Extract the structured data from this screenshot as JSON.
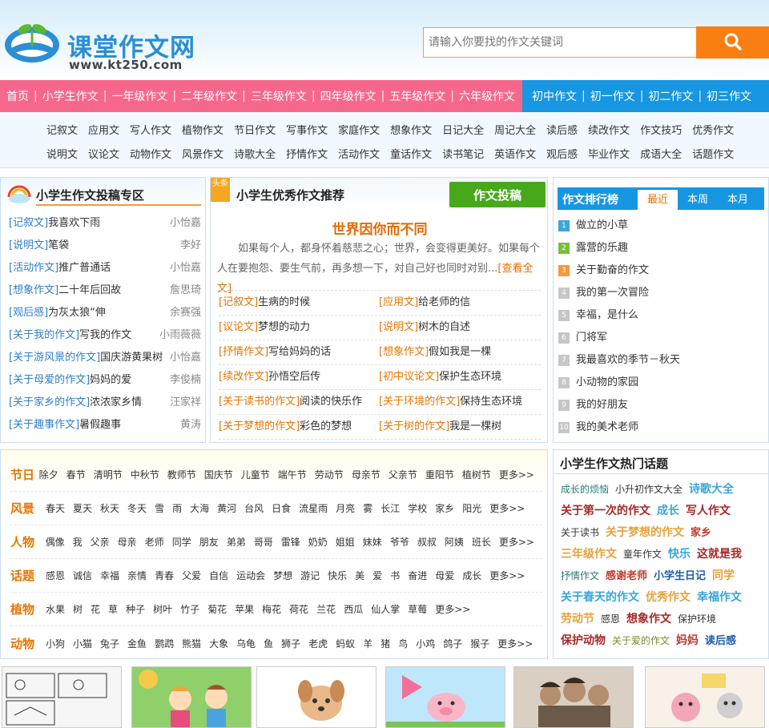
{
  "header": {
    "site_name": "课堂作文网",
    "site_url": "www.kt250.com",
    "search_placeholder": "请输入你要找的作文关键词",
    "search_icon": "search-icon"
  },
  "nav": {
    "main_items": [
      "首页",
      "小学生作文",
      "一年级作文",
      "二年级作文",
      "三年级作文",
      "四年级作文",
      "五年级作文",
      "六年级作文"
    ],
    "junior_items": [
      "初中作文",
      "初一作文",
      "初二作文",
      "初三作文"
    ],
    "primary_color": "#f7678c",
    "secondary_color": "#1796e2"
  },
  "subnav": {
    "row1": [
      "记叙文",
      "应用文",
      "写人作文",
      "植物作文",
      "节日作文",
      "写事作文",
      "家庭作文",
      "想象作文",
      "日记大全",
      "周记大全",
      "读后感",
      "续改作文",
      "作文技巧",
      "优秀作文"
    ],
    "row2": [
      "说明文",
      "议论文",
      "动物作文",
      "风景作文",
      "诗歌大全",
      "抒情作文",
      "活动作文",
      "童话作文",
      "读书笔记",
      "英语作文",
      "观后感",
      "毕业作文",
      "成语大全",
      "话题作文"
    ]
  },
  "submission": {
    "title": "小学生作文投稿专区",
    "items": [
      {
        "category": "[记叙文]",
        "title": "我喜欢下雨",
        "author": "小怡嘉"
      },
      {
        "category": "[说明文]",
        "title": "笔袋",
        "author": "李好"
      },
      {
        "category": "[活动作文]",
        "title": "推广普通话",
        "author": "小怡嘉"
      },
      {
        "category": "[想象作文]",
        "title": "二十年后回故",
        "author": "詹思琦"
      },
      {
        "category": "[观后感]",
        "title": "为灰太狼“伸",
        "author": "余赛强"
      },
      {
        "category": "[关于我的作文]",
        "title": "写我的作文",
        "author": "小雨薇薇"
      },
      {
        "category": "[关于游风景的作文]",
        "title": "国庆游黄果树",
        "author": "小怡嘉"
      },
      {
        "category": "[关于母爱的作文]",
        "title": "妈妈的爱",
        "author": "李俊楠"
      },
      {
        "category": "[关于家乡的作文]",
        "title": "浓浓家乡情",
        "author": "汪家祥"
      },
      {
        "category": "[关于趣事作文]",
        "title": "暑假趣事",
        "author": "黄涛"
      }
    ]
  },
  "featured": {
    "ribbon": "头条",
    "title": "小学生优秀作文推荐",
    "submit_label": "作文投稿",
    "article_title": "世界因你而不同",
    "article_summary": "如果每个人，都身怀着慈悲之心；世界，会变得更美好。如果每个人在要抱怨、要生气前，再多想一下，对自己好也同时对别...",
    "more_label": "[查看全文]",
    "items": [
      {
        "category": "[记叙文]",
        "title": "生病的时候"
      },
      {
        "category": "[应用文]",
        "title": "给老师的信"
      },
      {
        "category": "[议论文]",
        "title": "梦想的动力"
      },
      {
        "category": "[说明文]",
        "title": "树木的自述"
      },
      {
        "category": "[抒情作文]",
        "title": "写给妈妈的话"
      },
      {
        "category": "[想象作文]",
        "title": "假如我是一棵"
      },
      {
        "category": "[续改作文]",
        "title": "孙悟空后传"
      },
      {
        "category": "[初中议论文]",
        "title": "保护生态环境"
      },
      {
        "category": "[关于读书的作文]",
        "title": "阅读的快乐作"
      },
      {
        "category": "[关于环境的作文]",
        "title": "保持生态环境"
      },
      {
        "category": "[关于梦想的作文]",
        "title": "彩色的梦想"
      },
      {
        "category": "[关于树的作文]",
        "title": "我是一棵树"
      }
    ]
  },
  "ranking": {
    "title": "作文排行榜",
    "tabs": [
      "最近",
      "本周",
      "本月"
    ],
    "active_tab": "最近",
    "items": [
      {
        "rank": "1",
        "title": "做立的小草",
        "color": "#3ba5d9"
      },
      {
        "rank": "2",
        "title": "露营的乐趣",
        "color": "#7bbe3c"
      },
      {
        "rank": "3",
        "title": "关于勤奋的作文",
        "color": "#f09a3b"
      },
      {
        "rank": "4",
        "title": "我的第一次冒险",
        "color": "#c7c7c7"
      },
      {
        "rank": "5",
        "title": "幸福，是什么",
        "color": "#c7c7c7"
      },
      {
        "rank": "6",
        "title": "门将军",
        "color": "#c7c7c7"
      },
      {
        "rank": "7",
        "title": "我最喜欢的季节－秋天",
        "color": "#c7c7c7"
      },
      {
        "rank": "8",
        "title": "小动物的家园",
        "color": "#c7c7c7"
      },
      {
        "rank": "9",
        "title": "我的好朋友",
        "color": "#c7c7c7"
      },
      {
        "rank": "10",
        "title": "我的美术老师",
        "color": "#c7c7c7"
      }
    ]
  },
  "tags": [
    {
      "label": "节日",
      "items": [
        "除夕",
        "春节",
        "清明节",
        "中秋节",
        "教师节",
        "国庆节",
        "儿童节",
        "端午节",
        "劳动节",
        "母亲节",
        "父亲节",
        "重阳节",
        "植树节",
        "更多>>"
      ]
    },
    {
      "label": "风景",
      "items": [
        "春天",
        "夏天",
        "秋天",
        "冬天",
        "雪",
        "雨",
        "大海",
        "黄河",
        "台风",
        "日食",
        "流星雨",
        "月亮",
        "雾",
        "长江",
        "学校",
        "家乡",
        "阳光",
        "更多>>"
      ]
    },
    {
      "label": "人物",
      "items": [
        "偶像",
        "我",
        "父亲",
        "母亲",
        "老师",
        "同学",
        "朋友",
        "弟弟",
        "哥哥",
        "雷锋",
        "奶奶",
        "姐姐",
        "妹妹",
        "爷爷",
        "叔叔",
        "阿姨",
        "班长",
        "更多>>"
      ]
    },
    {
      "label": "话题",
      "items": [
        "感恩",
        "诚信",
        "幸福",
        "亲情",
        "青春",
        "父爱",
        "自信",
        "运动会",
        "梦想",
        "游记",
        "快乐",
        "美",
        "爱",
        "书",
        "奋进",
        "母爱",
        "成长",
        "更多>>"
      ]
    },
    {
      "label": "植物",
      "items": [
        "水果",
        "树",
        "花",
        "草",
        "种子",
        "树叶",
        "竹子",
        "菊花",
        "苹果",
        "梅花",
        "荷花",
        "兰花",
        "西瓜",
        "仙人掌",
        "草莓",
        "更多>>"
      ]
    },
    {
      "label": "动物",
      "items": [
        "小狗",
        "小猫",
        "兔子",
        "金鱼",
        "鹦鹉",
        "熊猫",
        "大象",
        "乌龟",
        "鱼",
        "狮子",
        "老虎",
        "蚂蚁",
        "羊",
        "猪",
        "鸟",
        "小鸡",
        "鸽子",
        "猴子",
        "更多>>"
      ]
    }
  ],
  "topics": {
    "title": "小学生作文热门话题",
    "items": [
      {
        "text": "成长的烦恼",
        "color": "#2a7b6f",
        "size": "small"
      },
      {
        "text": "小升初作文大全",
        "color": "#333333",
        "size": "small"
      },
      {
        "text": "诗歌大全",
        "color": "#3ba5d9",
        "size": "big"
      },
      {
        "text": "关于第一次的作文",
        "color": "#a52a2a",
        "size": "big"
      },
      {
        "text": "成长",
        "color": "#3ba5d9",
        "size": "big"
      },
      {
        "text": "写人作文",
        "color": "#a52a2a",
        "size": "big"
      },
      {
        "text": "关于读书",
        "color": "#333333",
        "size": "small"
      },
      {
        "text": "关于梦想的作文",
        "color": "#e6a23c",
        "size": "big"
      },
      {
        "text": "家乡",
        "color": "#c0392b",
        "size": "mid"
      },
      {
        "text": "三年级作文",
        "color": "#e6a23c",
        "size": "big"
      },
      {
        "text": "童年作文",
        "color": "#333333",
        "size": "small"
      },
      {
        "text": "快乐",
        "color": "#3ba5d9",
        "size": "big"
      },
      {
        "text": "这就是我",
        "color": "#a52a2a",
        "size": "big"
      },
      {
        "text": "抒情作文",
        "color": "#2a7b6f",
        "size": "small"
      },
      {
        "text": "感谢老师",
        "color": "#c0392b",
        "size": "mid"
      },
      {
        "text": "小学生日记",
        "color": "#1f5fa8",
        "size": "mid"
      },
      {
        "text": "同学",
        "color": "#e6a23c",
        "size": "big"
      },
      {
        "text": "关于春天的作文",
        "color": "#3ba5d9",
        "size": "big"
      },
      {
        "text": "优秀作文",
        "color": "#e6a23c",
        "size": "big"
      },
      {
        "text": "幸福作文",
        "color": "#3ba5d9",
        "size": "big"
      },
      {
        "text": "劳动节",
        "color": "#e6a23c",
        "size": "big"
      },
      {
        "text": "感恩",
        "color": "#333333",
        "size": "small"
      },
      {
        "text": "想象作文",
        "color": "#a52a2a",
        "size": "big"
      },
      {
        "text": "保护环境",
        "color": "#333333",
        "size": "small"
      },
      {
        "text": "保护动物",
        "color": "#a52a2a",
        "size": "big"
      },
      {
        "text": "关于爱的作文",
        "color": "#7a8a2a",
        "size": "small"
      },
      {
        "text": "妈妈",
        "color": "#c0392b",
        "size": "big"
      },
      {
        "text": "读后感",
        "color": "#1f5fa8",
        "size": "mid"
      }
    ]
  },
  "thumbnails": [
    "comic-strip",
    "girls-tennis",
    "puppy",
    "pig-kite",
    "family-portrait",
    "cartoon-cat"
  ]
}
